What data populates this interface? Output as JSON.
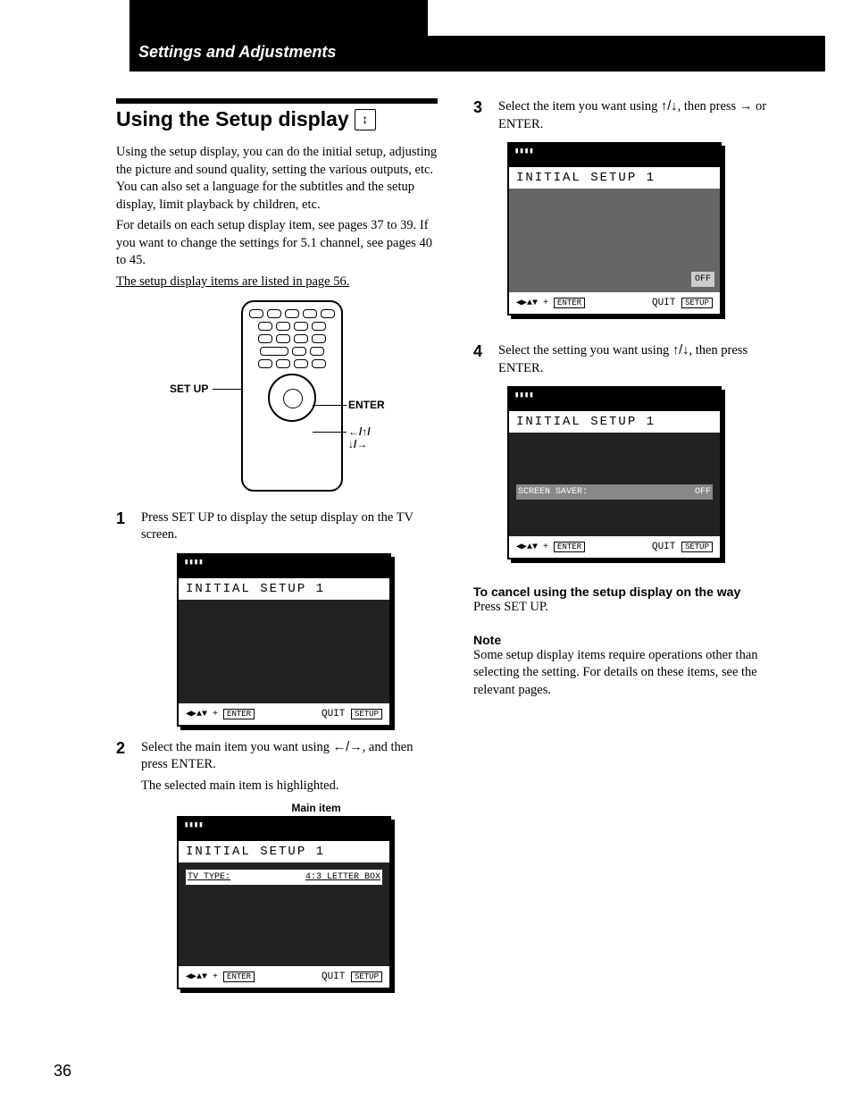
{
  "header": {
    "section": "Settings and Adjustments"
  },
  "title": "Using the Setup display",
  "intro": {
    "p1": "Using the setup display, you can do the initial setup, adjusting the picture and sound quality, setting the various outputs, etc. You can also set a language for the subtitles and the setup display, limit playback by children, etc.",
    "p2": "For details on each setup display item, see pages 37 to 39. If you want to change the settings for 5.1 channel, see pages 40 to 45.",
    "p3": "The setup display items are listed in page 56."
  },
  "remote": {
    "setup": "SET UP",
    "enter": "ENTER",
    "arrows": "←/↑/↓/→"
  },
  "steps": {
    "s1": {
      "num": "1",
      "text": "Press SET UP to display the setup display on the TV screen."
    },
    "s2": {
      "num": "2",
      "text_a": "Select the main item you want using ",
      "text_b": ", and then press ENTER.",
      "text_c": "The selected main item is highlighted.",
      "arrows": "←/→"
    },
    "s3": {
      "num": "3",
      "text_a": "Select the item you want using ",
      "text_b": ", then press ",
      "text_c": " or ENTER.",
      "arrows": "↑/↓",
      "arrow_right": "→"
    },
    "s4": {
      "num": "4",
      "text_a": "Select the setting you want using ",
      "text_b": ", then press ENTER.",
      "arrows": "↑/↓"
    }
  },
  "main_item_label": "Main item",
  "osd": {
    "title": "INITIAL SETUP 1",
    "quit": "QUIT",
    "setup_btn": "SETUP",
    "enter_btn": "ENTER",
    "tv_type_label": "TV TYPE:",
    "tv_type_val": "4:3 LETTER BOX",
    "screen_saver_label": "SCREEN SAVER:",
    "screen_saver_val": "OFF",
    "off": "OFF"
  },
  "cancel": {
    "head": "To cancel using the setup display on the way",
    "body": "Press SET UP."
  },
  "note": {
    "head": "Note",
    "body": "Some setup display items require operations other than selecting the setting. For details on these items, see the relevant pages."
  },
  "page_number": "36"
}
